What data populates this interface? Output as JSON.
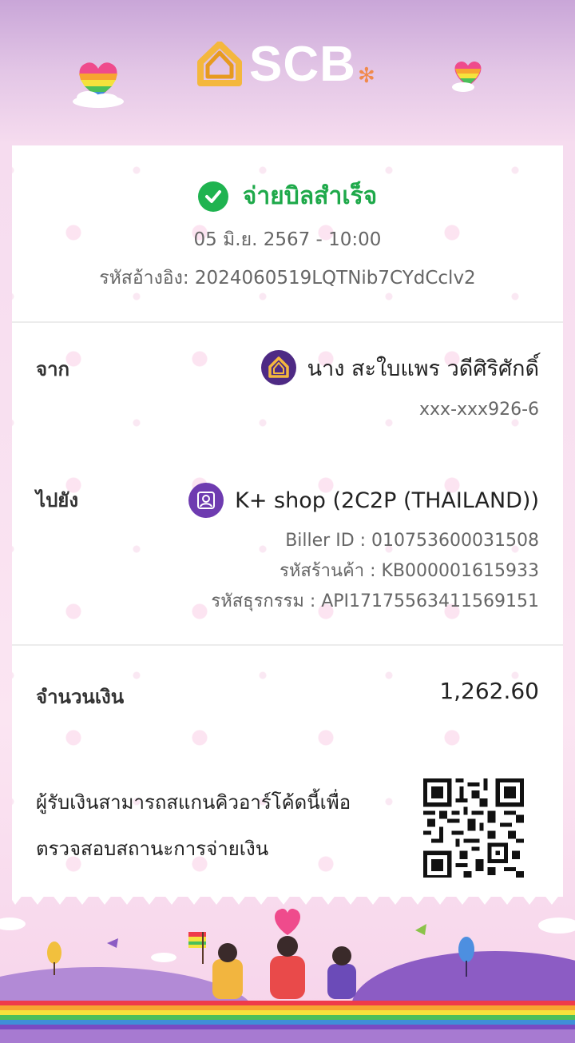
{
  "brand": {
    "name": "SCB"
  },
  "status": {
    "icon": "check-circle-icon",
    "text": "จ่ายบิลสำเร็จ",
    "color": "#1ea94a"
  },
  "datetime": "05 มิ.ย. 2567 - 10:00",
  "reference": "รหัสอ้างอิง: 2024060519LQTNib7CYdCclv2",
  "from": {
    "label": "จาก",
    "name": "นาง สะใบแพร วดีศิริศักดิ์",
    "account": "xxx-xxx926-6",
    "icon": "scb-logo-icon"
  },
  "to": {
    "label": "ไปยัง",
    "name": "K+ shop (2C2P (THAILAND))",
    "biller_id": "Biller ID : 010753600031508",
    "merchant_code": "รหัสร้านค้า : KB000001615933",
    "transaction_code": "รหัสธุรกรรม : API17175563411569151",
    "icon": "merchant-icon"
  },
  "amount": {
    "label": "จำนวนเงิน",
    "value": "1,262.60"
  },
  "qr": {
    "line1": "ผู้รับเงินสามารถสแกนคิวอาร์โค้ดนี้เพื่อ",
    "line2": "ตรวจสอบสถานะการจ่ายเงิน",
    "icon": "qr-code-icon"
  },
  "colors": {
    "brand_purple": "#4e2a84",
    "success_green": "#1fb350",
    "logo_gold": "#f4b73d"
  }
}
